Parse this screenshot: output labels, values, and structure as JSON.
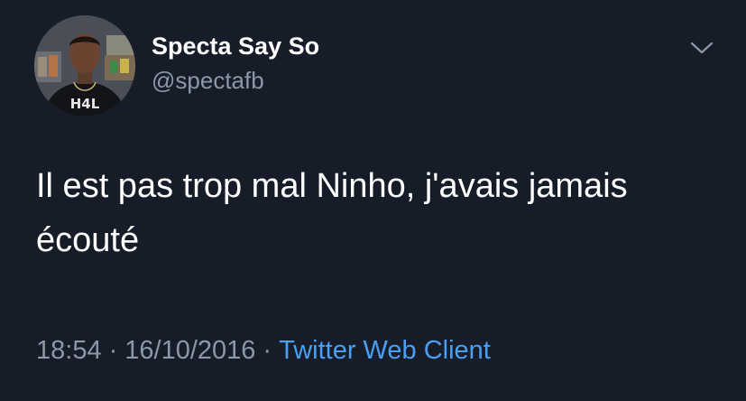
{
  "author": {
    "display_name": "Specta Say So",
    "handle": "@spectafb",
    "avatar_badge": "H4L"
  },
  "tweet": {
    "text": "Il est pas trop mal Ninho, j'avais jamais écouté",
    "time": "18:54",
    "date": "16/10/2016",
    "separator": "·",
    "source": "Twitter Web Client"
  },
  "icons": {
    "menu": "chevron-down-icon"
  },
  "colors": {
    "background": "#161d29",
    "text_primary": "#ffffff",
    "text_secondary": "#8b98a5",
    "link": "#4b9ff2"
  }
}
